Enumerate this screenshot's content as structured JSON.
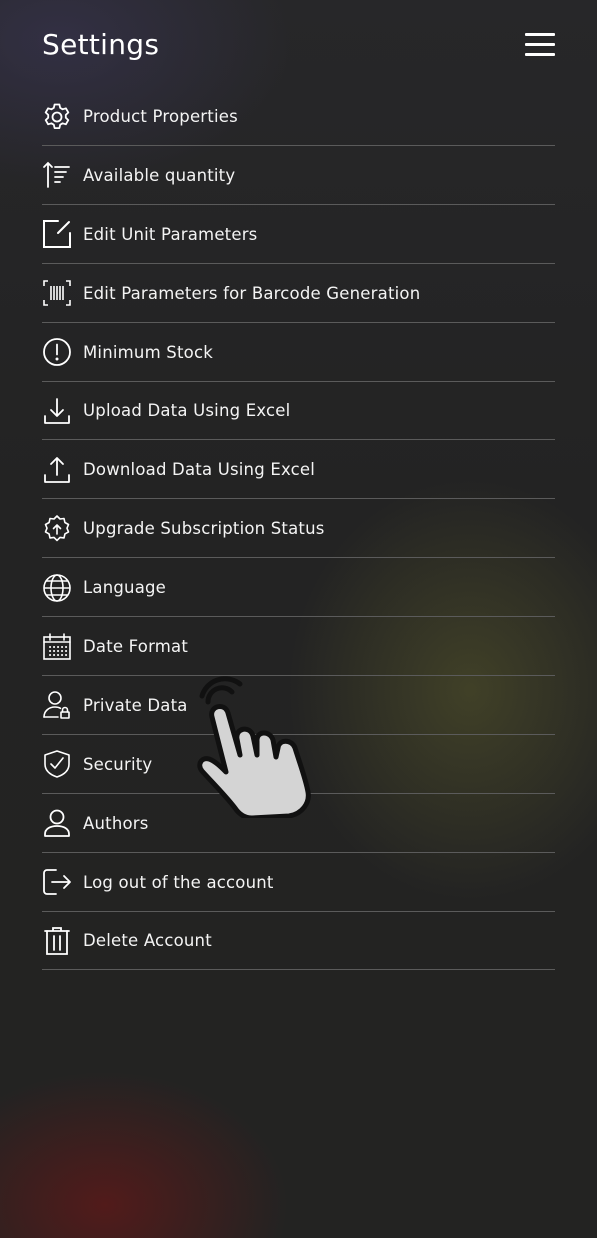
{
  "header": {
    "title": "Settings",
    "menu_icon": "hamburger-menu-icon"
  },
  "settings": {
    "items": [
      {
        "label": "Product Properties",
        "icon": "gear-icon"
      },
      {
        "label": "Available quantity",
        "icon": "sort-ascending-icon"
      },
      {
        "label": "Edit Unit Parameters",
        "icon": "edit-square-icon"
      },
      {
        "label": "Edit Parameters for Barcode Generation",
        "icon": "barcode-icon"
      },
      {
        "label": "Minimum Stock",
        "icon": "alert-circle-icon"
      },
      {
        "label": "Upload Data Using Excel",
        "icon": "download-arrow-icon"
      },
      {
        "label": "Download Data Using Excel",
        "icon": "upload-arrow-icon"
      },
      {
        "label": "Upgrade Subscription Status",
        "icon": "badge-upgrade-icon"
      },
      {
        "label": "Language",
        "icon": "globe-icon"
      },
      {
        "label": "Date Format",
        "icon": "calendar-icon"
      },
      {
        "label": "Private Data",
        "icon": "user-lock-icon"
      },
      {
        "label": "Security",
        "icon": "shield-check-icon"
      },
      {
        "label": "Authors",
        "icon": "user-icon"
      },
      {
        "label": "Log out of the account",
        "icon": "logout-icon"
      },
      {
        "label": "Delete Account",
        "icon": "trash-icon"
      }
    ]
  },
  "overlay": {
    "pointer_icon": "tap-hand-icon"
  },
  "colors": {
    "background": "#232323",
    "text": "#ffffff",
    "divider": "#5b5b5b"
  }
}
